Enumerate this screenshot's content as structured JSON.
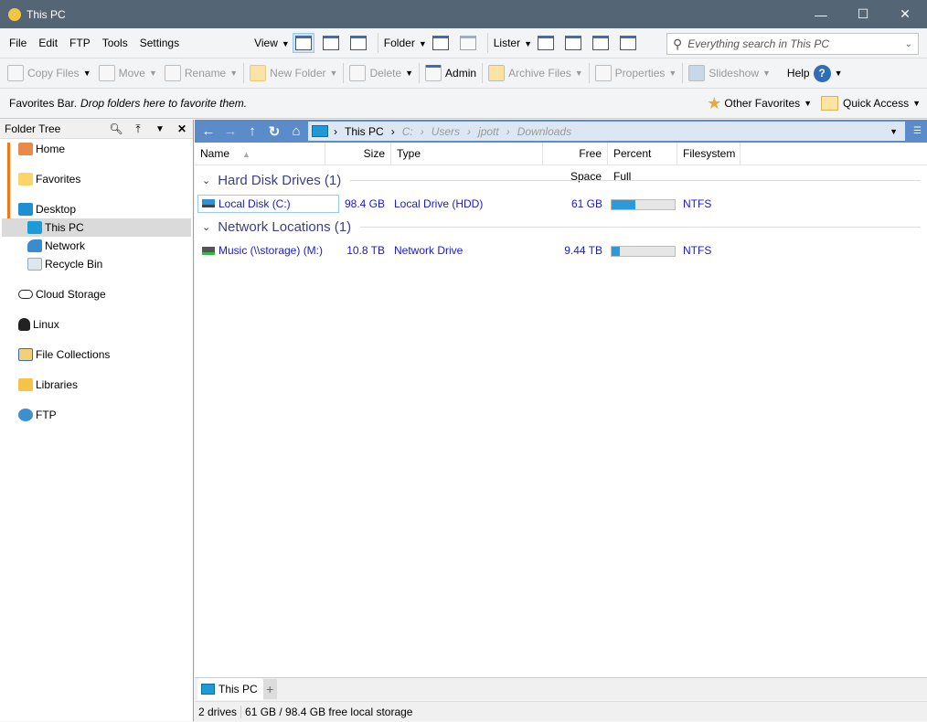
{
  "window": {
    "title": "This PC",
    "minimize": "—",
    "maximize": "☐",
    "close": "✕"
  },
  "menu": [
    "File",
    "Edit",
    "FTP",
    "Tools",
    "Settings"
  ],
  "view_menu": {
    "view": "View",
    "folder": "Folder",
    "lister": "Lister"
  },
  "search": {
    "placeholder": "Everything search in This PC"
  },
  "toolbar": {
    "copy": "Copy Files",
    "move": "Move",
    "rename": "Rename",
    "new_folder": "New Folder",
    "delete": "Delete",
    "admin": "Admin",
    "archive": "Archive Files",
    "properties": "Properties",
    "slideshow": "Slideshow",
    "help": "Help"
  },
  "favbar": {
    "label": "Favorites Bar.",
    "hint": "Drop folders here to favorite them.",
    "other": "Other Favorites",
    "quick": "Quick Access"
  },
  "tree": {
    "title": "Folder Tree",
    "items": [
      "Home",
      "Favorites",
      "Desktop",
      "This PC",
      "Network",
      "Recycle Bin",
      "Cloud Storage",
      "Linux",
      "File Collections",
      "Libraries",
      "FTP"
    ],
    "selected": "This PC"
  },
  "breadcrumb": [
    "This PC",
    "C:",
    "Users",
    "jpott",
    "Downloads"
  ],
  "columns": [
    "Name",
    "Size",
    "Type",
    "Free Space",
    "Percent Full",
    "Filesystem"
  ],
  "groups": [
    {
      "title": "Hard Disk Drives (1)",
      "rows": [
        {
          "name": "Local Disk (C:)",
          "size": "98.4 GB",
          "type": "Local Drive (HDD)",
          "free": "61 GB",
          "percent_full": 38,
          "fs": "NTFS"
        }
      ]
    },
    {
      "title": "Network Locations (1)",
      "rows": [
        {
          "name": "Music (\\\\storage) (M:)",
          "size": "10.8 TB",
          "type": "Network Drive",
          "free": "9.44 TB",
          "percent_full": 13,
          "fs": "NTFS"
        }
      ]
    }
  ],
  "tabs": {
    "active": "This PC",
    "add": "+"
  },
  "status": {
    "count": "2 drives",
    "storage": "61 GB / 98.4 GB free local storage"
  },
  "colors": {
    "titlebar": "#546575",
    "navbar": "#5b8bc9",
    "accent": "#2a9ad8",
    "tree_line": "#f07818"
  }
}
